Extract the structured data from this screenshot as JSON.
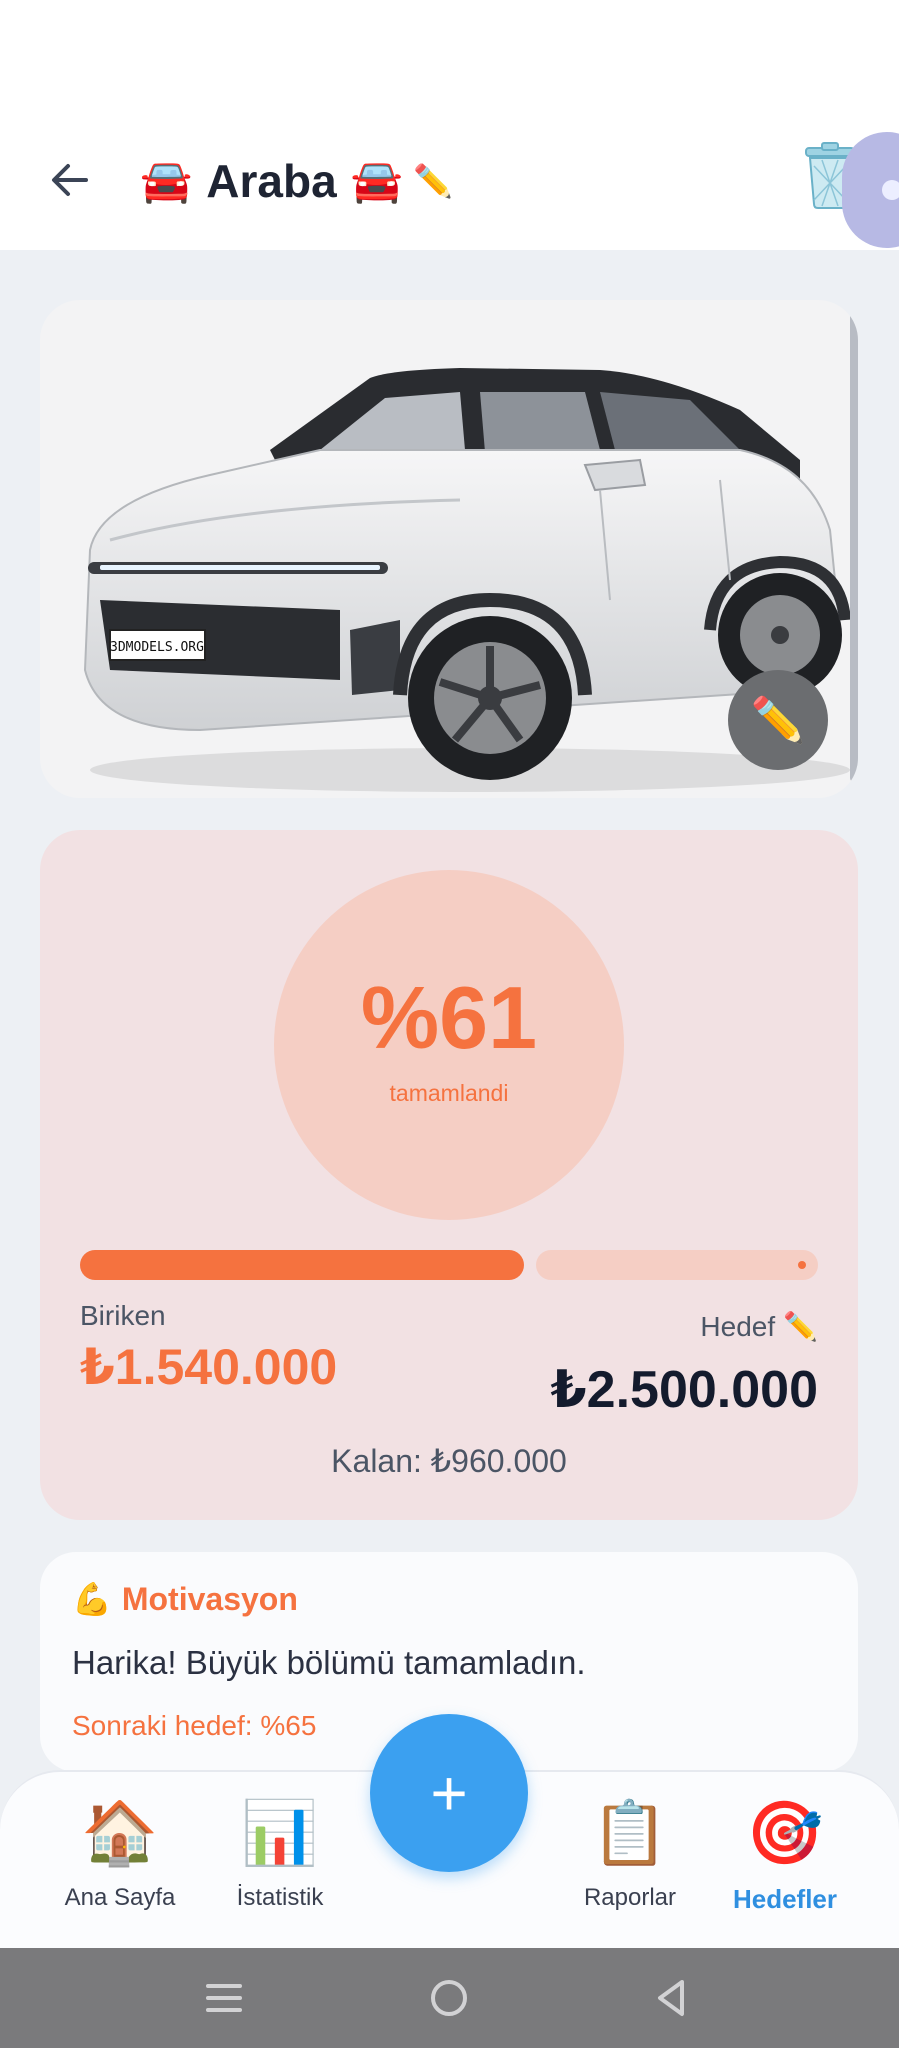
{
  "header": {
    "title_prefix": "🚘",
    "title": "Araba",
    "title_suffix": "🚘",
    "edit_glyph": "✏️",
    "back_icon": "arrow-left",
    "delete_icon": "wastebasket"
  },
  "image_card": {
    "image_text": "3DMODELS.ORG",
    "edit_glyph": "✏️"
  },
  "progress": {
    "percent_text": "%61",
    "percent_value": 0.61,
    "percent_label": "tamamlandi",
    "saved_label": "Biriken",
    "saved_value": "₺1.540.000",
    "goal_label": "Hedef",
    "goal_edit_glyph": "✏️",
    "goal_value": "₺2.500.000",
    "remaining_text": "Kalan: ₺960.000",
    "colors": {
      "accent": "#f5723f",
      "track": "#f5cec4",
      "card": "#f2e1e3"
    }
  },
  "motivation": {
    "icon": "💪",
    "title": "Motivasyon",
    "text": "Harika! Büyük bölümü tamamladın.",
    "next_goal": "Sonraki hedef: %65"
  },
  "nav": {
    "items": [
      {
        "icon": "🏠",
        "label": "Ana Sayfa",
        "active": false
      },
      {
        "icon": "📊",
        "label": "İstatistik",
        "active": false
      },
      {
        "icon": "📋",
        "label": "Raporlar",
        "active": false
      },
      {
        "icon": "🎯",
        "label": "Hedefler",
        "active": true
      }
    ],
    "fab_label": "+",
    "active_color": "#2f8fe0"
  }
}
